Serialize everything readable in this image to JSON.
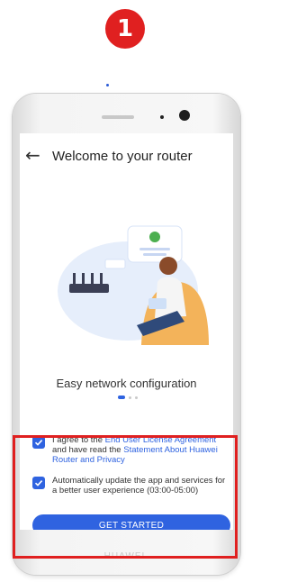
{
  "step_badge": "1",
  "header": {
    "title": "Welcome to your router"
  },
  "onboarding": {
    "caption": "Easy network configuration",
    "page_index": 1,
    "page_count": 3
  },
  "consent": {
    "agreement": {
      "checked": true,
      "prefix": "I agree to the ",
      "eula_link": "End User License Agreement",
      "middle": " and have read the ",
      "privacy_link": "Statement About Huawei Router and Privacy"
    },
    "auto_update": {
      "checked": true,
      "text": "Automatically update the app and services for a better user experience (03:00-05:00)"
    },
    "button_label": "GET STARTED"
  },
  "device": {
    "brand": "HUAWEI"
  },
  "colors": {
    "accent": "#2f63e0",
    "highlight": "#e02020",
    "badge": "#e02020"
  },
  "icons": {
    "back": "arrow-left-icon",
    "check": "check-icon"
  }
}
